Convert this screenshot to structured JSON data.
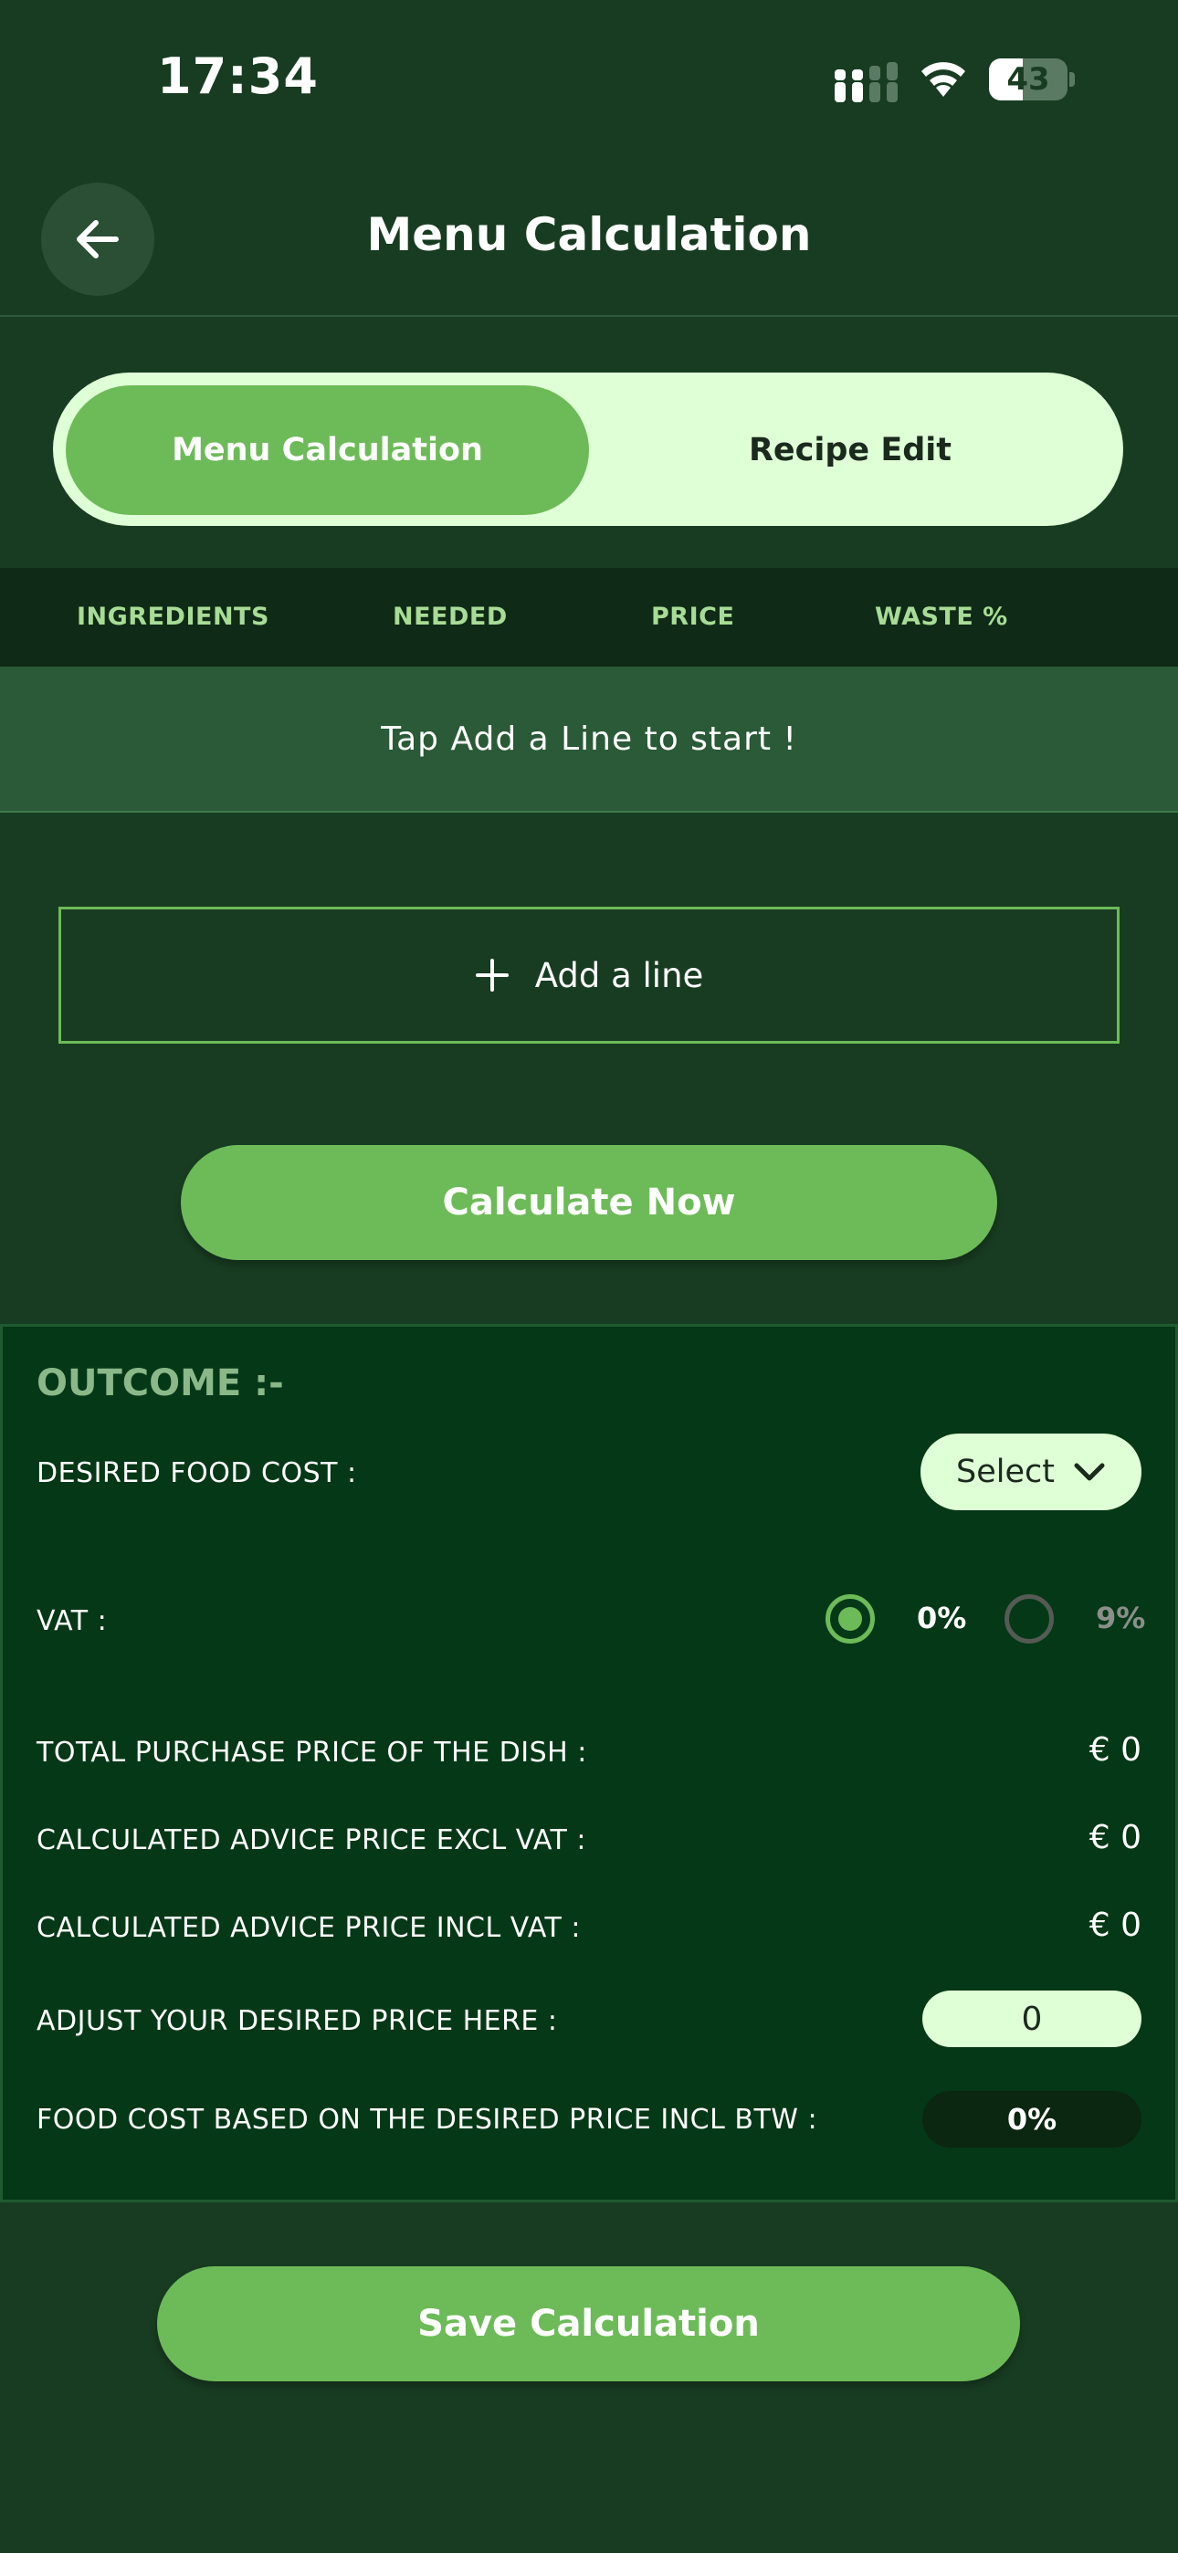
{
  "status_bar": {
    "time": "17:34",
    "battery_level": "43",
    "icons": [
      "signal-icon",
      "wifi-icon",
      "battery-icon"
    ]
  },
  "header": {
    "title": "Menu Calculation",
    "back_icon": "arrow-left-icon"
  },
  "tabs": [
    {
      "label": "Menu Calculation",
      "active": true
    },
    {
      "label": "Recipe Edit",
      "active": false
    }
  ],
  "table": {
    "columns": [
      "INGREDIENTS",
      "NEEDED",
      "PRICE",
      "WASTE %"
    ],
    "empty_message": "Tap Add a Line to start !"
  },
  "add_line": {
    "label": "Add a line",
    "icon": "plus-icon"
  },
  "calculate_label": "Calculate Now",
  "outcome": {
    "title": "OUTCOME :-",
    "desired_food_cost_label": "DESIRED FOOD COST :",
    "select_label": "Select",
    "vat_label": "VAT :",
    "vat_options": [
      {
        "label": "0%",
        "selected": true
      },
      {
        "label": "9%",
        "selected": false
      }
    ],
    "total_purchase_label": "TOTAL PURCHASE PRICE OF THE DISH :",
    "total_purchase_value": "€ 0",
    "advice_excl_label": "CALCULATED ADVICE PRICE EXCL VAT :",
    "advice_excl_value": "€ 0",
    "advice_incl_label": "CALCULATED ADVICE PRICE INCL VAT :",
    "advice_incl_value": "€ 0",
    "desired_price_label": "ADJUST YOUR DESIRED PRICE HERE :",
    "desired_price_value": "0",
    "food_cost_label": "FOOD COST BASED ON THE DESIRED PRICE INCL BTW :",
    "food_cost_value": "0%"
  },
  "save_label": "Save Calculation",
  "colors": {
    "background": "#183c22",
    "accent": "#6dbb58",
    "light": "#dfffd6",
    "outcome_bg": "#053817"
  }
}
